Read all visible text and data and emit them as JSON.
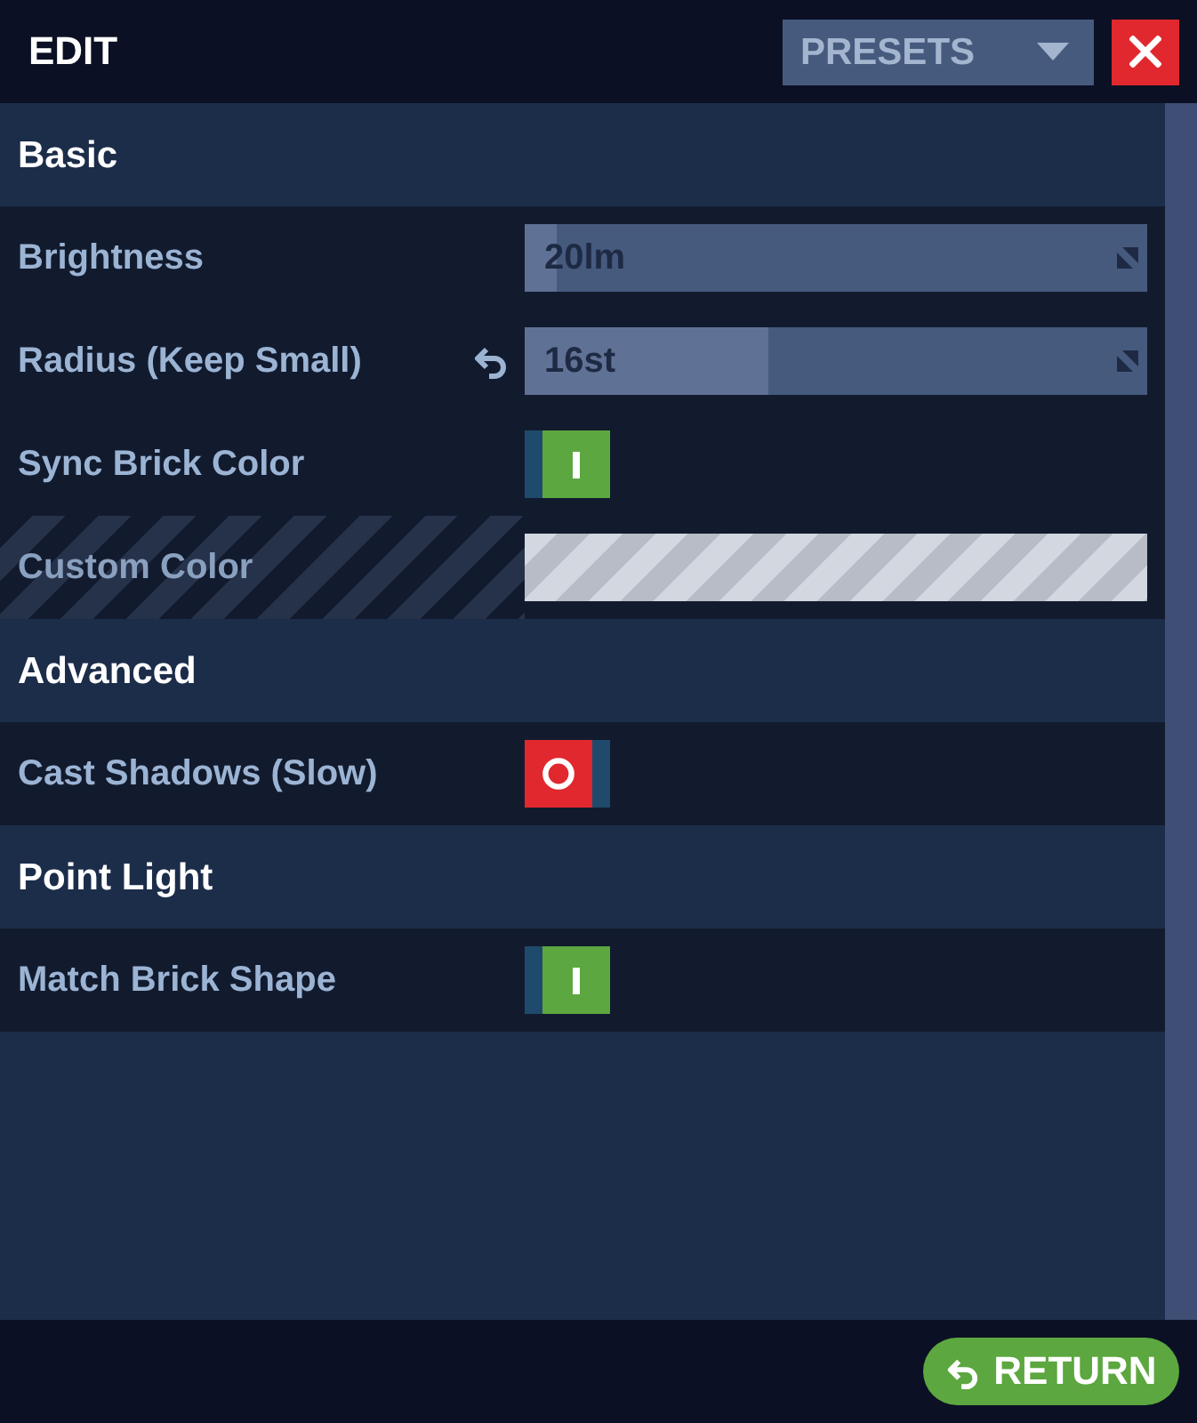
{
  "header": {
    "title": "EDIT",
    "presets": {
      "label": "PRESETS"
    }
  },
  "sections": [
    {
      "title": "Basic",
      "rows": [
        {
          "kind": "slider",
          "label": "Brightness",
          "value": "20lm",
          "level": 0.05,
          "modified": false
        },
        {
          "kind": "slider",
          "label": "Radius (Keep Small)",
          "value": "16st",
          "level": 0.39,
          "modified": true
        },
        {
          "kind": "toggle",
          "label": "Sync Brick Color",
          "on": true
        },
        {
          "kind": "color",
          "label": "Custom Color",
          "disabled": true
        }
      ]
    },
    {
      "title": "Advanced",
      "rows": [
        {
          "kind": "toggle",
          "label": "Cast Shadows (Slow)",
          "on": false
        }
      ]
    },
    {
      "title": "Point Light",
      "rows": [
        {
          "kind": "toggle",
          "label": "Match Brick Shape",
          "on": true
        }
      ]
    }
  ],
  "footer": {
    "return_button": {
      "label": "RETURN"
    }
  }
}
